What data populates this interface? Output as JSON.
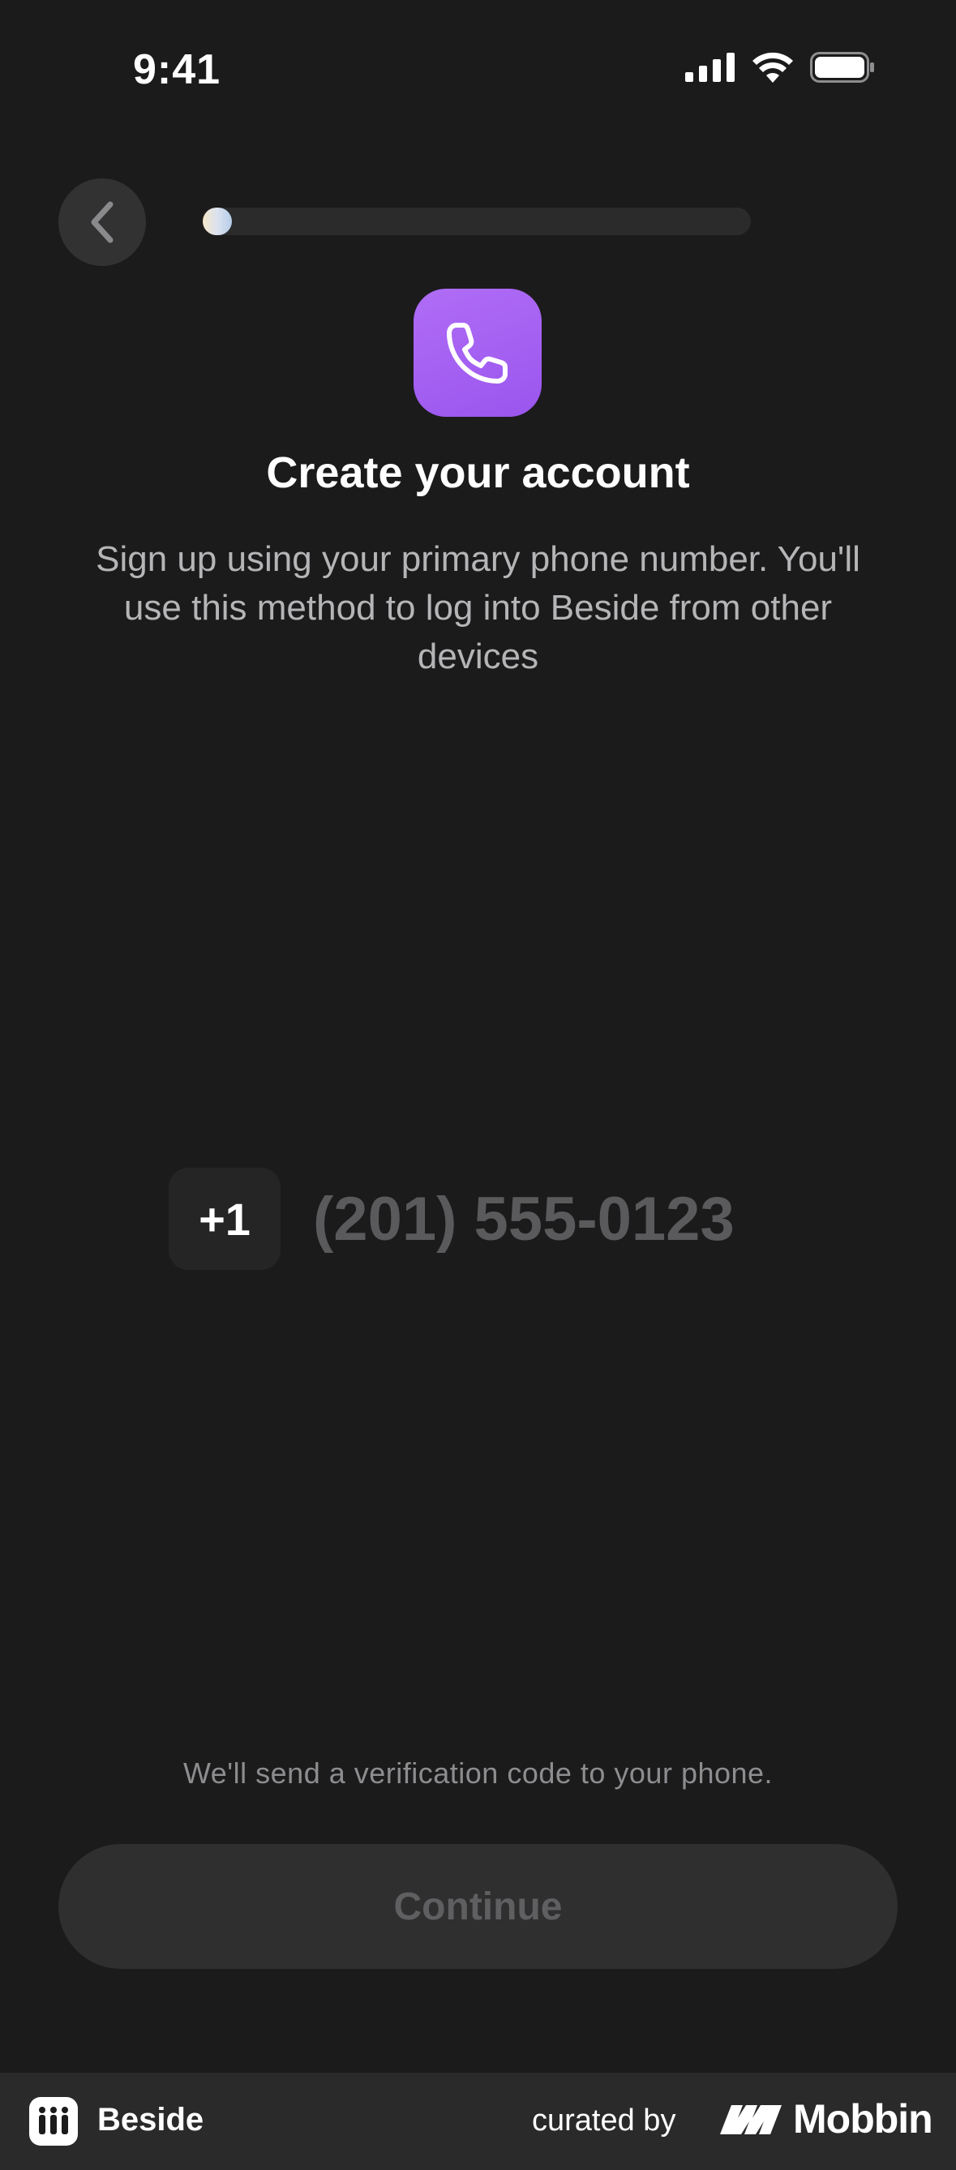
{
  "status_bar": {
    "time": "9:41"
  },
  "header": {
    "progress_fraction": 0.03
  },
  "hero": {
    "title": "Create your account",
    "subtitle": "Sign up using your primary phone number. You'll use this method to log into Beside from other devices"
  },
  "phone_form": {
    "country_code": "+1",
    "phone_value": "",
    "phone_placeholder": "(201) 555-0123"
  },
  "footer_note": "We'll send a verification code to your phone.",
  "continue_label": "Continue",
  "attribution": {
    "app_name": "Beside",
    "curated_by": "curated by",
    "brand": "Mobbin"
  },
  "colors": {
    "background": "#1b1b1c",
    "accent_purple": "#a561f2",
    "button_disabled": "#2f2f30"
  }
}
